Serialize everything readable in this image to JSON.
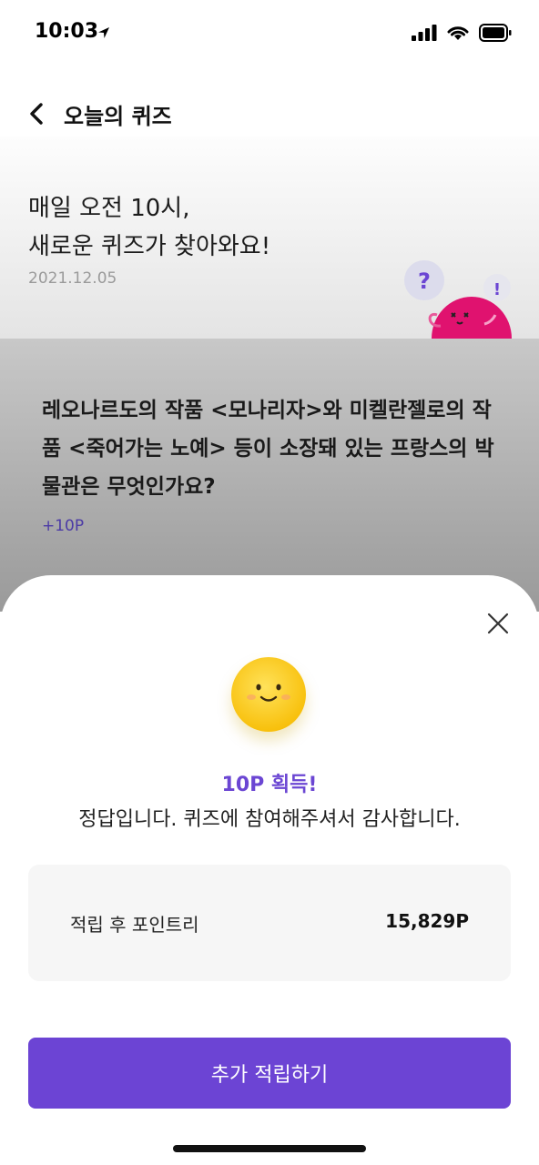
{
  "status_bar": {
    "time": "10:03"
  },
  "header": {
    "title": "오늘의 퀴즈"
  },
  "intro": {
    "title_line1": "매일 오전 10시,",
    "title_line2": "새로운 퀴즈가 찾아와요!",
    "date": "2021.12.05",
    "mascot_question_mark": "?",
    "mascot_exclamation": "!"
  },
  "quiz": {
    "question": "레오나르도의 작품 <모나리자>와 미켈란젤로의 작품 <죽어가는 노예> 등이 소장돼 있는 프랑스의 박물관은 무엇인가요?",
    "points": "+10P"
  },
  "result_sheet": {
    "title": "10P 획득!",
    "message": "정답입니다. 퀴즈에 참여해주셔서 감사합니다.",
    "points_label": "적립 후 포인트리",
    "points_value": "15,829P",
    "cta_label": "추가 적립하기"
  },
  "colors": {
    "accent": "#6C44D4",
    "mascot": "#E0126F",
    "emoji": "#F8C10E"
  }
}
